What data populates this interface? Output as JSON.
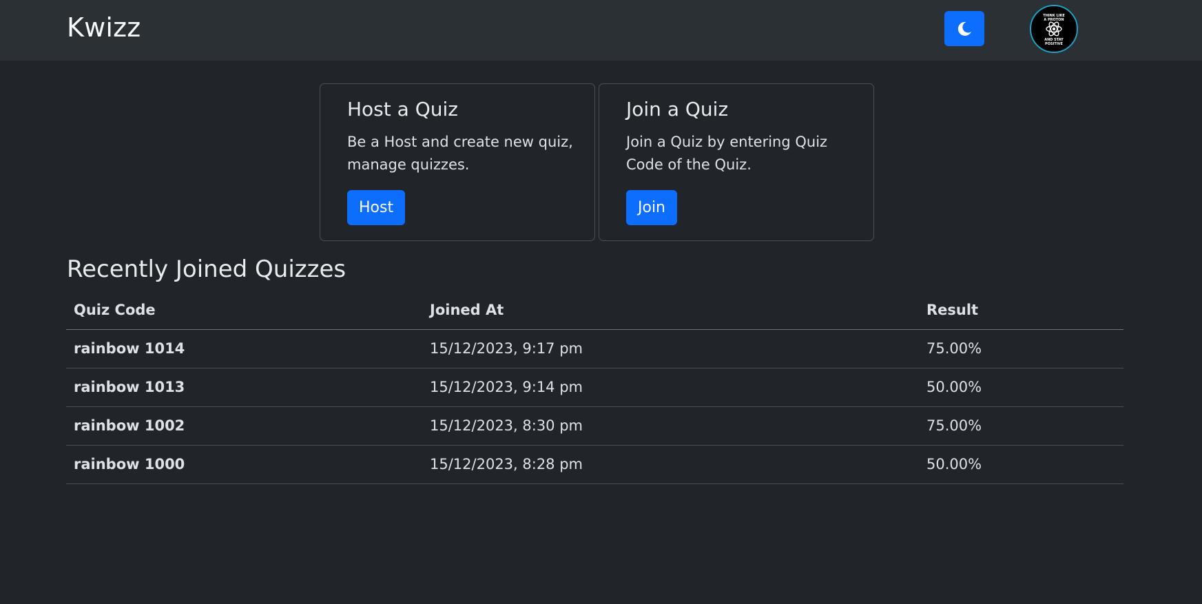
{
  "navbar": {
    "brand": "Kwizz",
    "theme_toggle_icon": "moon-icon",
    "avatar_text": [
      "THINK LIKE",
      "A PROTON",
      "AND STAY",
      "POSITIVE"
    ]
  },
  "cards": {
    "host": {
      "title": "Host a Quiz",
      "text": "Be a Host and create new quiz, manage quizzes.",
      "button": "Host"
    },
    "join": {
      "title": "Join a Quiz",
      "text": "Join a Quiz by entering Quiz Code of the Quiz.",
      "button": "Join"
    }
  },
  "recent": {
    "title": "Recently Joined Quizzes",
    "columns": [
      "Quiz Code",
      "Joined At",
      "Result"
    ],
    "rows": [
      {
        "code": "rainbow 1014",
        "joined_at": "15/12/2023, 9:17 pm",
        "result": "75.00%"
      },
      {
        "code": "rainbow 1013",
        "joined_at": "15/12/2023, 9:14 pm",
        "result": "50.00%"
      },
      {
        "code": "rainbow 1002",
        "joined_at": "15/12/2023, 8:30 pm",
        "result": "75.00%"
      },
      {
        "code": "rainbow 1000",
        "joined_at": "15/12/2023, 8:28 pm",
        "result": "50.00%"
      }
    ]
  },
  "colors": {
    "background": "#212529",
    "navbar": "#2b3035",
    "primary": "#0d6efd",
    "avatar_ring": "#1ba3c6"
  }
}
